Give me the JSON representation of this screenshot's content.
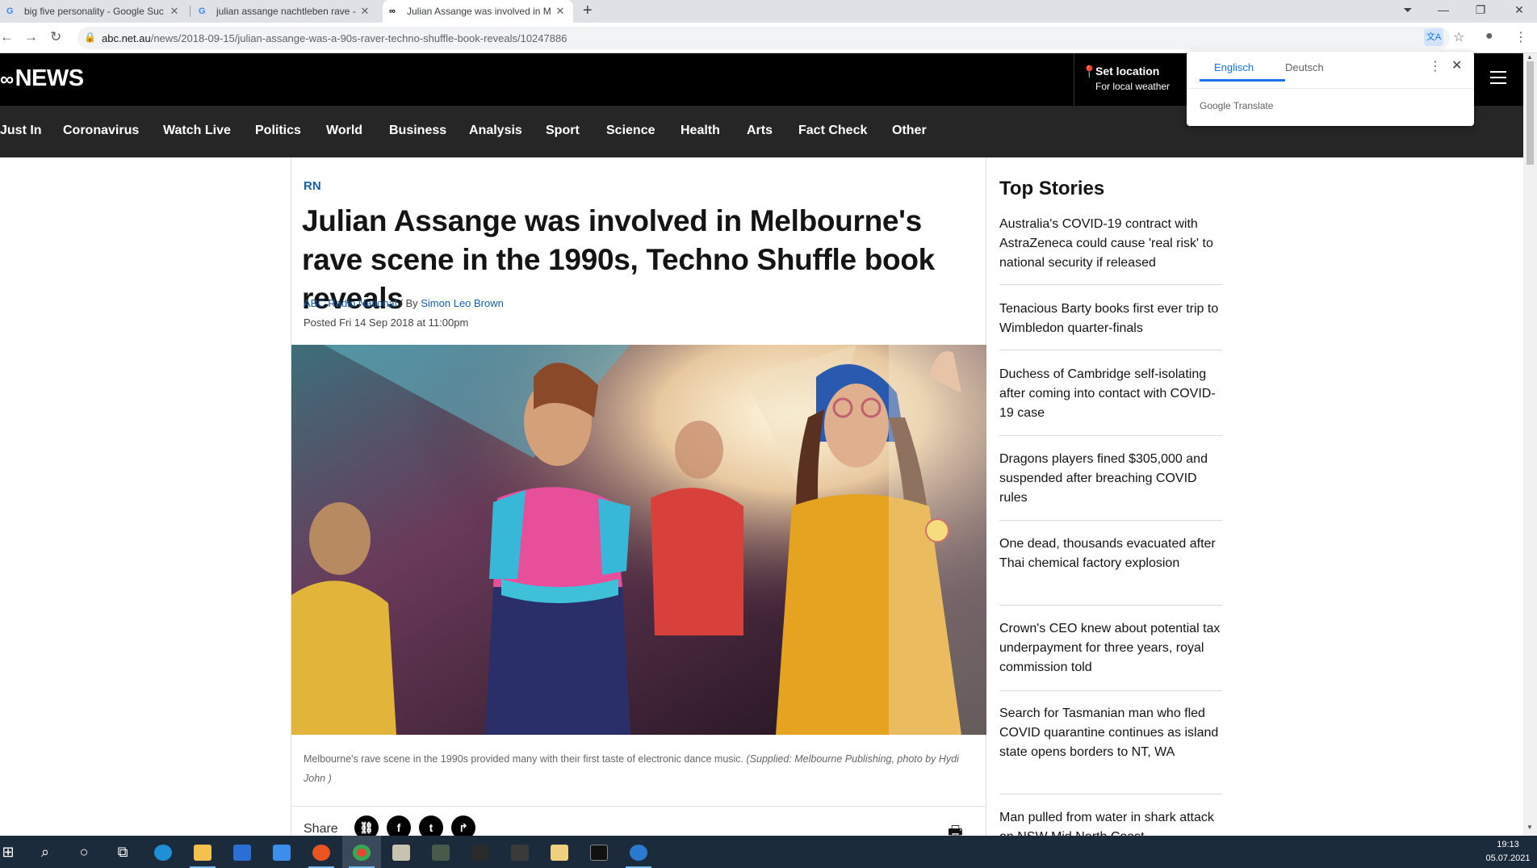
{
  "browser": {
    "tabs": [
      {
        "label": "big five personality - Google Suc",
        "icon": "google-icon"
      },
      {
        "label": "julian assange nachtleben rave -",
        "icon": "google-icon"
      },
      {
        "label": "Julian Assange was involved in M",
        "icon": "abc-icon"
      }
    ],
    "url_host": "abc.net.au",
    "url_path": "/news/2018-09-15/julian-assange-was-a-90s-raver-techno-shuffle-book-reveals/10247886"
  },
  "site": {
    "logo": "NEWS",
    "set_location": "Set location",
    "set_location_sub": "For local weather",
    "nav": [
      "Just In",
      "Coronavirus",
      "Watch Live",
      "Politics",
      "World",
      "Business",
      "Analysis",
      "Sport",
      "Science",
      "Health",
      "Arts",
      "Fact Check",
      "Other"
    ]
  },
  "translate": {
    "source_lang": "Englisch",
    "target_lang": "Deutsch",
    "brand": "Google Translate"
  },
  "article": {
    "kicker": "RN",
    "headline": "Julian Assange was involved in Melbourne's rave scene in the 1990s, Techno Shuffle book reveals",
    "source": "ABC Radio National",
    "by": " / By ",
    "author": "Simon Leo Brown",
    "posted_label": "Posted ",
    "posted_date": "Fri 14 Sep 2018 at 11:00pm",
    "caption": "Melbourne's rave scene in the 1990s provided many with their first taste of electronic dance music. ",
    "caption_credit": "(Supplied: Melbourne Publishing, photo by Hydi John )",
    "share_label": "Share"
  },
  "sidebar": {
    "title": "Top Stories",
    "stories": [
      "Australia's COVID-19 contract with AstraZeneca could cause 'real risk' to national security if released",
      "Tenacious Barty books first ever trip to Wimbledon quarter-finals",
      "Duchess of Cambridge self-isolating after coming into contact with COVID-19 case",
      "Dragons players fined $305,000 and suspended after breaching COVID rules",
      "One dead, thousands evacuated after Thai chemical factory explosion",
      "Crown's CEO knew about potential tax underpayment for three years, royal commission told",
      "Search for Tasmanian man who fled COVID quarantine continues as island state opens borders to NT, WA",
      "Man pulled from water in shark attack on NSW Mid North Coast"
    ]
  },
  "taskbar": {
    "time": "19:13",
    "date": "05.07.2021"
  },
  "colors": {
    "accent_link": "#1460aa",
    "header_bg": "#000000",
    "nav_bg": "#262626",
    "taskbar_bg": "#1c2b3c"
  }
}
